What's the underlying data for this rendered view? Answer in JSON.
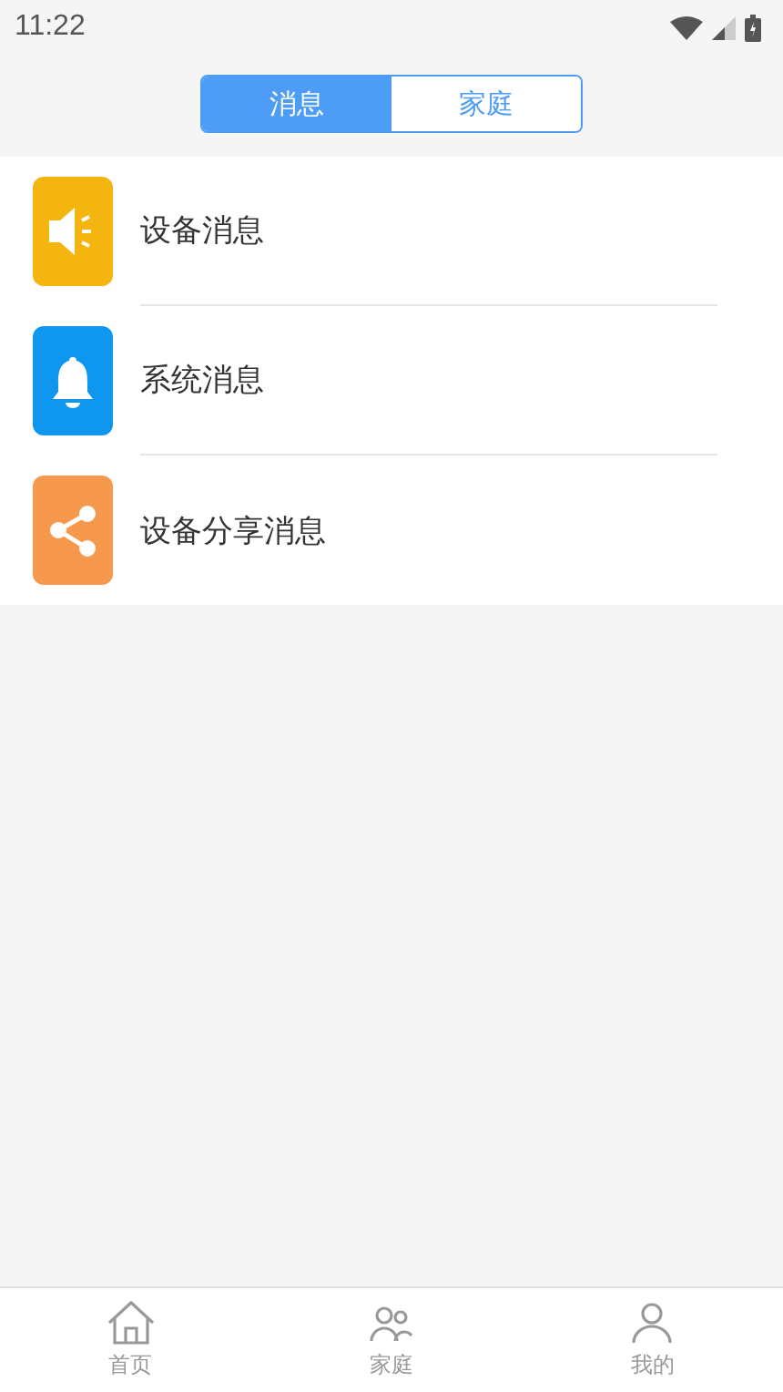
{
  "status_bar": {
    "time": "11:22"
  },
  "segments": [
    {
      "label": "消息",
      "selected": true
    },
    {
      "label": "家庭",
      "selected": false
    }
  ],
  "messages": [
    {
      "kind": "speaker",
      "label": "设备消息",
      "color": "#f5b50f"
    },
    {
      "kind": "bell",
      "label": "系统消息",
      "color": "#0f96ee"
    },
    {
      "kind": "share",
      "label": "设备分享消息",
      "color": "#f7994c"
    }
  ],
  "bottom_nav": [
    {
      "kind": "home",
      "label": "首页",
      "selected": false
    },
    {
      "kind": "family",
      "label": "家庭",
      "selected": false
    },
    {
      "kind": "me",
      "label": "我的",
      "selected": false
    }
  ]
}
